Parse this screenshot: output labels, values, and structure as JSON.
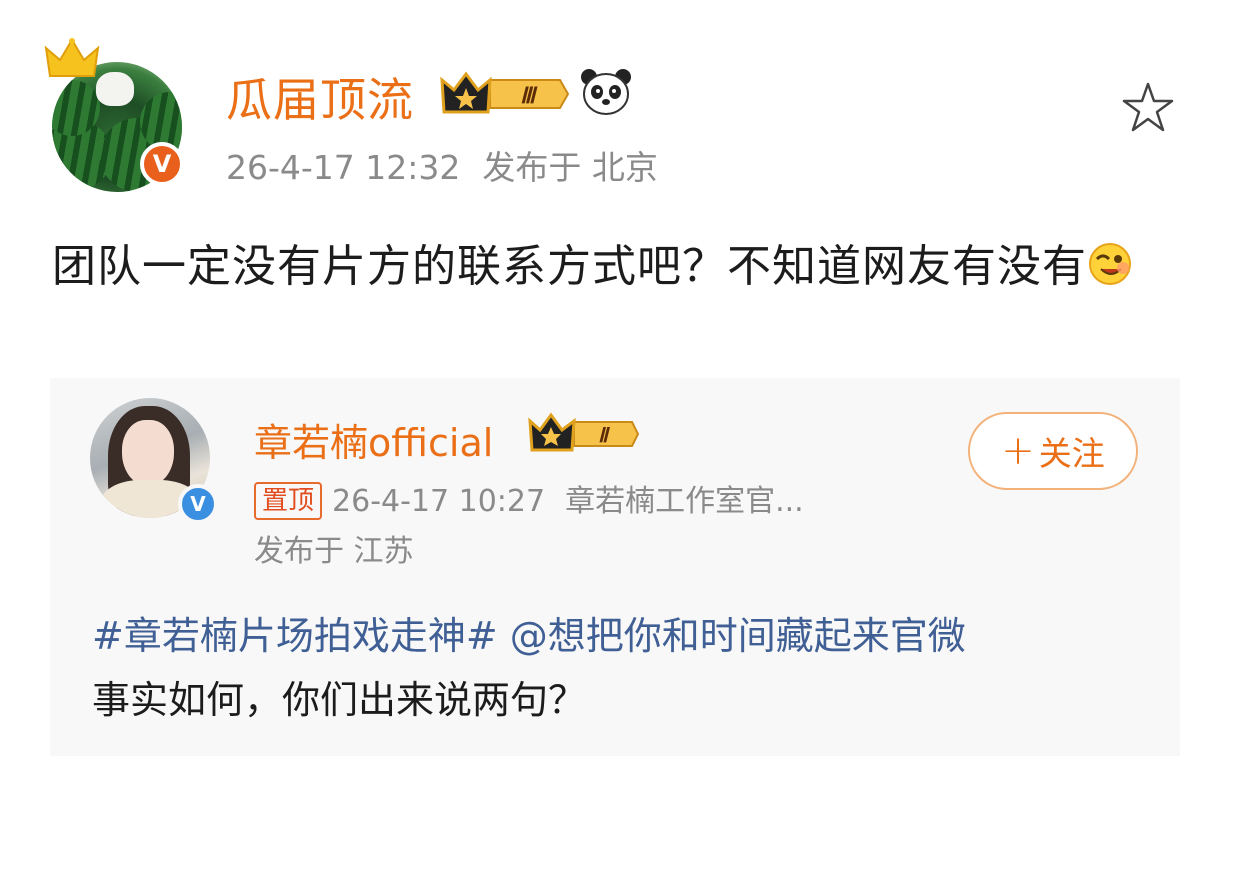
{
  "post": {
    "username": "瓜届顶流",
    "vip_level": "Ⅲ",
    "time": "26-4-17 12:32",
    "location": "发布于 北京",
    "text": "团队一定没有片方的联系方式吧？不知道网友有没有"
  },
  "retweet": {
    "username": "章若楠official",
    "vip_level": "Ⅱ",
    "follow_label": "关注",
    "follow_plus": "+",
    "pin_label": "置顶",
    "time": "26-4-17 10:27",
    "source": "章若楠工作室官...",
    "location": "发布于 江苏",
    "hashtag": "#章若楠片场拍戏走神#",
    "mention": "@想把你和时间藏起来官微",
    "text_line2": "事实如何，你们出来说两句？"
  },
  "colors": {
    "username": "#ea6f16",
    "meta": "#8a8a8a",
    "link": "#3f5f95",
    "verified_orange": "#e8601c",
    "verified_blue": "#3b8fe0"
  },
  "icons": {
    "crown": "crown-icon",
    "verified": "verified-v-icon",
    "panda": "panda-icon",
    "star": "star-icon",
    "emoji": "wink-emoji-icon"
  }
}
